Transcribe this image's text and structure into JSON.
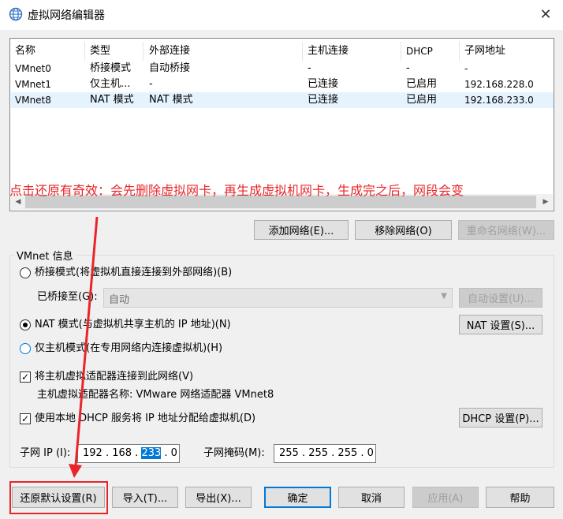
{
  "window": {
    "title": "虚拟网络编辑器",
    "close_symbol": "✕"
  },
  "table": {
    "columns": [
      "名称",
      "类型",
      "外部连接",
      "主机连接",
      "DHCP",
      "子网地址"
    ],
    "rows": [
      {
        "name": "VMnet0",
        "type": "桥接模式",
        "external": "自动桥接",
        "host": "-",
        "dhcp": "-",
        "subnet": "-"
      },
      {
        "name": "VMnet1",
        "type": "仅主机...",
        "external": "-",
        "host": "已连接",
        "dhcp": "已启用",
        "subnet": "192.168.228.0"
      },
      {
        "name": "VMnet8",
        "type": "NAT 模式",
        "external": "NAT 模式",
        "host": "已连接",
        "dhcp": "已启用",
        "subnet": "192.168.233.0"
      }
    ],
    "selected_row": 2
  },
  "annotation_text": "点击还原有奇效：会先删除虚拟网卡，再生成虚拟机网卡，生成完之后，网段会变",
  "list_buttons": {
    "add": "添加网络(E)...",
    "remove": "移除网络(O)",
    "rename": "重命名网络(W)..."
  },
  "vmnet_info": {
    "group_title": "VMnet 信息",
    "bridge_radio": "桥接模式(将虚拟机直接连接到外部网络)(B)",
    "bridged_to_label": "已桥接至(G):",
    "bridged_to_value": "自动",
    "auto_settings": "自动设置(U)...",
    "nat_radio": "NAT 模式(与虚拟机共享主机的 IP 地址)(N)",
    "nat_settings": "NAT 设置(S)...",
    "hostonly_radio": "仅主机模式(在专用网络内连接虚拟机)(H)",
    "connect_adapter": "将主机虚拟适配器连接到此网络(V)",
    "adapter_name": "主机虚拟适配器名称: VMware 网络适配器 VMnet8",
    "use_dhcp": "使用本地 DHCP 服务将 IP 地址分配给虚拟机(D)",
    "dhcp_settings": "DHCP 设置(P)...",
    "subnet_ip_label": "子网 IP (I):",
    "subnet_ip_prefix": "192 . 168 .",
    "subnet_ip_selected": "233",
    "subnet_ip_suffix": ". 0",
    "subnet_mask_label": "子网掩码(M):",
    "subnet_mask_value": "255 . 255 . 255 . 0",
    "selected_mode": "nat",
    "connect_adapter_checked": true,
    "use_dhcp_checked": true
  },
  "bottom_buttons": {
    "restore": "还原默认设置(R)",
    "import": "导入(T)...",
    "export": "导出(X)...",
    "ok": "确定",
    "cancel": "取消",
    "apply": "应用(A)",
    "help": "帮助"
  },
  "colors": {
    "accent": "#0078d7",
    "annotation_red": "#e8262a",
    "selected_row": "#e5f3ff"
  }
}
